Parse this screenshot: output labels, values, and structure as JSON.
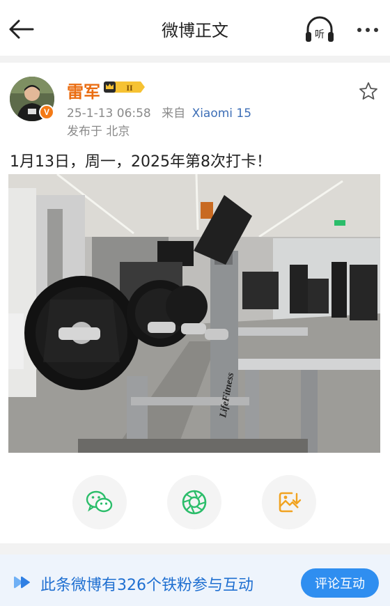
{
  "header": {
    "title": "微博正文",
    "listen_label": "听"
  },
  "post": {
    "author": "雷军",
    "vip_level": "II",
    "verified_mark": "V",
    "date": "25-1-13 06:58",
    "source_label": "来自",
    "device": "Xiaomi 15",
    "location": "发布于 北京",
    "text": "1月13日，周一，2025年第8次打卡！",
    "photo_brand_text": "LifeFitness"
  },
  "share": {
    "items": [
      "wechat-icon",
      "moments-icon",
      "save-image-icon"
    ]
  },
  "bottom_bar": {
    "text": "此条微博有326个铁粉参与互动",
    "button_label": "评论互动"
  },
  "colors": {
    "username": "#ea6d12",
    "link": "#3d6eb6",
    "accent_blue": "#2f8ef0",
    "wechat_green": "#2bbd6a"
  }
}
